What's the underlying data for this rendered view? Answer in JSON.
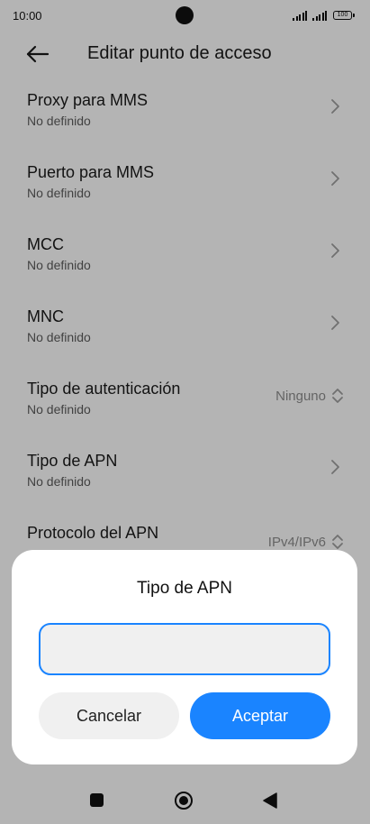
{
  "status_bar": {
    "time": "10:00",
    "battery": "100"
  },
  "header": {
    "title": "Editar punto de acceso",
    "back_icon": "arrow-left-icon"
  },
  "settings": [
    {
      "title": "Proxy para MMS",
      "subtitle": "No definido",
      "trailing": "",
      "icon": "chevron-right-icon"
    },
    {
      "title": "Puerto para MMS",
      "subtitle": "No definido",
      "trailing": "",
      "icon": "chevron-right-icon"
    },
    {
      "title": "MCC",
      "subtitle": "No definido",
      "trailing": "",
      "icon": "chevron-right-icon"
    },
    {
      "title": "MNC",
      "subtitle": "No definido",
      "trailing": "",
      "icon": "chevron-right-icon"
    },
    {
      "title": "Tipo de autenticación",
      "subtitle": "No definido",
      "trailing": "Ninguno",
      "icon": "chevron-updown-icon"
    },
    {
      "title": "Tipo de APN",
      "subtitle": "No definido",
      "trailing": "",
      "icon": "chevron-right-icon"
    },
    {
      "title": "Protocolo del APN",
      "subtitle": "",
      "trailing": "IPv4/IPv6",
      "icon": "chevron-updown-icon"
    }
  ],
  "dialog": {
    "title": "Tipo de APN",
    "input_value": "",
    "cancel_label": "Cancelar",
    "ok_label": "Aceptar"
  },
  "nav_bar": {
    "icons": [
      "recents-square-icon",
      "home-circle-icon",
      "back-triangle-icon"
    ]
  },
  "colors": {
    "accent": "#1a84ff",
    "dialog_bg": "#ffffff",
    "input_bg": "#f0f0f0"
  }
}
